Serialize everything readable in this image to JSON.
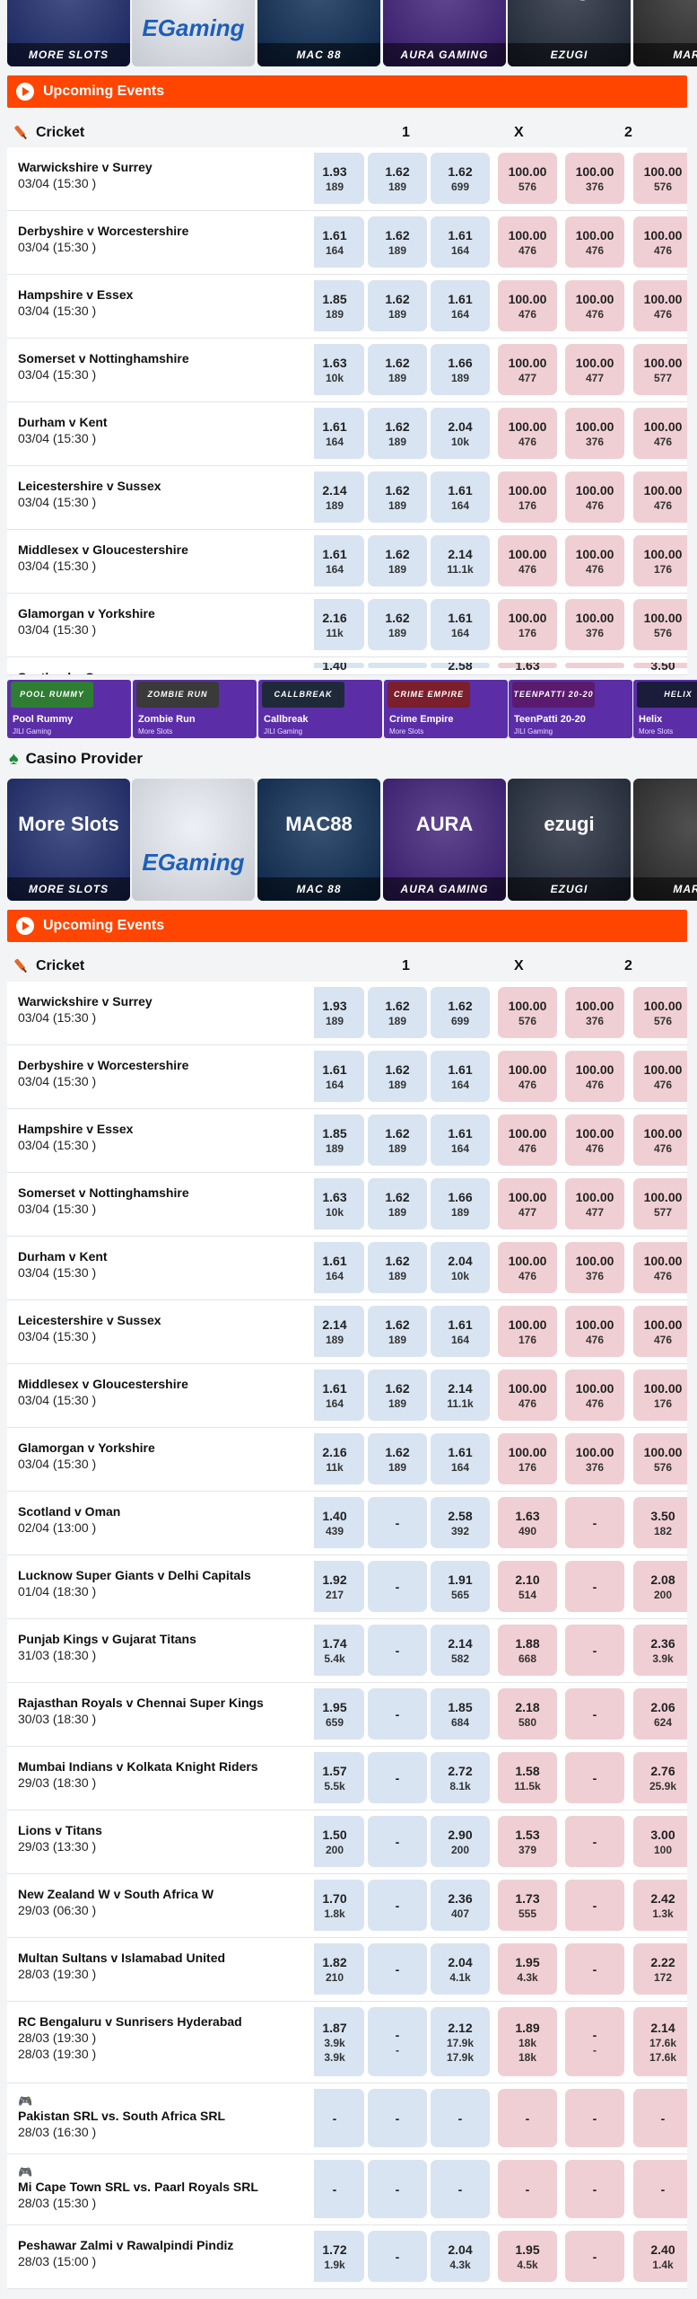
{
  "providers": [
    {
      "title": "More Slots",
      "label": "MORE SLOTS",
      "color": "#1b2a6b"
    },
    {
      "title": "EGaming",
      "label": "",
      "color": "#e9eef5"
    },
    {
      "title": "MAC88",
      "label": "MAC 88",
      "color": "#0b2b52"
    },
    {
      "title": "AURA",
      "label": "AURA GAMING",
      "color": "#3d1d78"
    },
    {
      "title": "ezugi",
      "label": "EZUGI",
      "color": "#222a3a"
    },
    {
      "title": "",
      "label": "MARBL",
      "color": "#2b2b2b"
    }
  ],
  "upcoming": {
    "title": "Upcoming Events"
  },
  "sport": {
    "name": "Cricket",
    "col1": "1",
    "colx": "X",
    "col2": "2"
  },
  "casino_provider": {
    "title": "Casino Provider"
  },
  "games": [
    {
      "banner": "POOL RUMMY",
      "name": "Pool Rummy",
      "provider": "JILI Gaming",
      "color": "#2e7d32"
    },
    {
      "banner": "ZOMBIE RUN",
      "name": "Zombie Run",
      "provider": "More Slots",
      "color": "#3a3a3a"
    },
    {
      "banner": "CALLBREAK",
      "name": "Callbreak",
      "provider": "JILI Gaming",
      "color": "#1e2a3a"
    },
    {
      "banner": "CRIME EMPIRE",
      "name": "Crime Empire",
      "provider": "More Slots",
      "color": "#7a1f2b"
    },
    {
      "banner": "TEENPATTI 20-20",
      "name": "TeenPatti 20-20",
      "provider": "JILI Gaming",
      "color": "#5a1b6e"
    },
    {
      "banner": "HELIX",
      "name": "Helix",
      "provider": "More Slots",
      "color": "#1b1b3a"
    }
  ],
  "events_top": [
    {
      "name": "Warwickshire v Surrey",
      "date": "03/04 (15:30 )",
      "odds": [
        [
          "1.93",
          "189"
        ],
        [
          "1.62",
          "189"
        ],
        [
          "1.62",
          "699"
        ],
        [
          "100.00",
          "576"
        ],
        [
          "100.00",
          "376"
        ],
        [
          "100.00",
          "576"
        ]
      ]
    },
    {
      "name": "Derbyshire v Worcestershire",
      "date": "03/04 (15:30 )",
      "odds": [
        [
          "1.61",
          "164"
        ],
        [
          "1.62",
          "189"
        ],
        [
          "1.61",
          "164"
        ],
        [
          "100.00",
          "476"
        ],
        [
          "100.00",
          "476"
        ],
        [
          "100.00",
          "476"
        ]
      ]
    },
    {
      "name": "Hampshire v Essex",
      "date": "03/04 (15:30 )",
      "odds": [
        [
          "1.85",
          "189"
        ],
        [
          "1.62",
          "189"
        ],
        [
          "1.61",
          "164"
        ],
        [
          "100.00",
          "476"
        ],
        [
          "100.00",
          "476"
        ],
        [
          "100.00",
          "476"
        ]
      ]
    },
    {
      "name": "Somerset v Nottinghamshire",
      "date": "03/04 (15:30 )",
      "odds": [
        [
          "1.63",
          "10k"
        ],
        [
          "1.62",
          "189"
        ],
        [
          "1.66",
          "189"
        ],
        [
          "100.00",
          "477"
        ],
        [
          "100.00",
          "477"
        ],
        [
          "100.00",
          "577"
        ]
      ]
    },
    {
      "name": "Durham v Kent",
      "date": "03/04 (15:30 )",
      "odds": [
        [
          "1.61",
          "164"
        ],
        [
          "1.62",
          "189"
        ],
        [
          "2.04",
          "10k"
        ],
        [
          "100.00",
          "476"
        ],
        [
          "100.00",
          "376"
        ],
        [
          "100.00",
          "476"
        ]
      ]
    },
    {
      "name": "Leicestershire v Sussex",
      "date": "03/04 (15:30 )",
      "odds": [
        [
          "2.14",
          "189"
        ],
        [
          "1.62",
          "189"
        ],
        [
          "1.61",
          "164"
        ],
        [
          "100.00",
          "176"
        ],
        [
          "100.00",
          "476"
        ],
        [
          "100.00",
          "476"
        ]
      ]
    },
    {
      "name": "Middlesex v Gloucestershire",
      "date": "03/04 (15:30 )",
      "odds": [
        [
          "1.61",
          "164"
        ],
        [
          "1.62",
          "189"
        ],
        [
          "2.14",
          "11.1k"
        ],
        [
          "100.00",
          "476"
        ],
        [
          "100.00",
          "476"
        ],
        [
          "100.00",
          "176"
        ]
      ]
    },
    {
      "name": "Glamorgan v Yorkshire",
      "date": "03/04 (15:30 )",
      "odds": [
        [
          "2.16",
          "11k"
        ],
        [
          "1.62",
          "189"
        ],
        [
          "1.61",
          "164"
        ],
        [
          "100.00",
          "176"
        ],
        [
          "100.00",
          "376"
        ],
        [
          "100.00",
          "576"
        ]
      ]
    },
    {
      "name": "Scotland v Oman",
      "date": "",
      "odds": [
        [
          "1.40",
          ""
        ],
        [
          "",
          ""
        ],
        [
          "2.58",
          ""
        ],
        [
          "1.63",
          ""
        ],
        [
          "",
          ""
        ],
        [
          "3.50",
          ""
        ]
      ]
    }
  ],
  "events": [
    {
      "name": "Warwickshire v Surrey",
      "date": "03/04 (15:30 )",
      "odds": [
        [
          "1.93",
          "189"
        ],
        [
          "1.62",
          "189"
        ],
        [
          "1.62",
          "699"
        ],
        [
          "100.00",
          "576"
        ],
        [
          "100.00",
          "376"
        ],
        [
          "100.00",
          "576"
        ]
      ]
    },
    {
      "name": "Derbyshire v Worcestershire",
      "date": "03/04 (15:30 )",
      "odds": [
        [
          "1.61",
          "164"
        ],
        [
          "1.62",
          "189"
        ],
        [
          "1.61",
          "164"
        ],
        [
          "100.00",
          "476"
        ],
        [
          "100.00",
          "476"
        ],
        [
          "100.00",
          "476"
        ]
      ]
    },
    {
      "name": "Hampshire v Essex",
      "date": "03/04 (15:30 )",
      "odds": [
        [
          "1.85",
          "189"
        ],
        [
          "1.62",
          "189"
        ],
        [
          "1.61",
          "164"
        ],
        [
          "100.00",
          "476"
        ],
        [
          "100.00",
          "476"
        ],
        [
          "100.00",
          "476"
        ]
      ]
    },
    {
      "name": "Somerset v Nottinghamshire",
      "date": "03/04 (15:30 )",
      "odds": [
        [
          "1.63",
          "10k"
        ],
        [
          "1.62",
          "189"
        ],
        [
          "1.66",
          "189"
        ],
        [
          "100.00",
          "477"
        ],
        [
          "100.00",
          "477"
        ],
        [
          "100.00",
          "577"
        ]
      ]
    },
    {
      "name": "Durham v Kent",
      "date": "03/04 (15:30 )",
      "odds": [
        [
          "1.61",
          "164"
        ],
        [
          "1.62",
          "189"
        ],
        [
          "2.04",
          "10k"
        ],
        [
          "100.00",
          "476"
        ],
        [
          "100.00",
          "376"
        ],
        [
          "100.00",
          "476"
        ]
      ]
    },
    {
      "name": "Leicestershire v Sussex",
      "date": "03/04 (15:30 )",
      "odds": [
        [
          "2.14",
          "189"
        ],
        [
          "1.62",
          "189"
        ],
        [
          "1.61",
          "164"
        ],
        [
          "100.00",
          "176"
        ],
        [
          "100.00",
          "476"
        ],
        [
          "100.00",
          "476"
        ]
      ]
    },
    {
      "name": "Middlesex v Gloucestershire",
      "date": "03/04 (15:30 )",
      "odds": [
        [
          "1.61",
          "164"
        ],
        [
          "1.62",
          "189"
        ],
        [
          "2.14",
          "11.1k"
        ],
        [
          "100.00",
          "476"
        ],
        [
          "100.00",
          "476"
        ],
        [
          "100.00",
          "176"
        ]
      ]
    },
    {
      "name": "Glamorgan v Yorkshire",
      "date": "03/04 (15:30 )",
      "odds": [
        [
          "2.16",
          "11k"
        ],
        [
          "1.62",
          "189"
        ],
        [
          "1.61",
          "164"
        ],
        [
          "100.00",
          "176"
        ],
        [
          "100.00",
          "376"
        ],
        [
          "100.00",
          "576"
        ]
      ]
    },
    {
      "name": "Scotland v Oman",
      "date": "02/04 (13:00 )",
      "odds": [
        [
          "1.40",
          "439"
        ],
        [
          "-",
          ""
        ],
        [
          "2.58",
          "392"
        ],
        [
          "1.63",
          "490"
        ],
        [
          "-",
          ""
        ],
        [
          "3.50",
          "182"
        ]
      ]
    },
    {
      "name": "Lucknow Super Giants v Delhi Capitals",
      "date": "01/04 (18:30 )",
      "odds": [
        [
          "1.92",
          "217"
        ],
        [
          "-",
          ""
        ],
        [
          "1.91",
          "565"
        ],
        [
          "2.10",
          "514"
        ],
        [
          "-",
          ""
        ],
        [
          "2.08",
          "200"
        ]
      ]
    },
    {
      "name": "Punjab Kings v Gujarat Titans",
      "date": "31/03 (18:30 )",
      "odds": [
        [
          "1.74",
          "5.4k"
        ],
        [
          "-",
          ""
        ],
        [
          "2.14",
          "582"
        ],
        [
          "1.88",
          "668"
        ],
        [
          "-",
          ""
        ],
        [
          "2.36",
          "3.9k"
        ]
      ]
    },
    {
      "name": "Rajasthan Royals v Chennai Super Kings",
      "date": "30/03 (18:30 )",
      "odds": [
        [
          "1.95",
          "659"
        ],
        [
          "-",
          ""
        ],
        [
          "1.85",
          "684"
        ],
        [
          "2.18",
          "580"
        ],
        [
          "-",
          ""
        ],
        [
          "2.06",
          "624"
        ]
      ]
    },
    {
      "name": "Mumbai Indians v Kolkata Knight Riders",
      "date": "29/03 (18:30 )",
      "odds": [
        [
          "1.57",
          "5.5k"
        ],
        [
          "-",
          ""
        ],
        [
          "2.72",
          "8.1k"
        ],
        [
          "1.58",
          "11.5k"
        ],
        [
          "-",
          ""
        ],
        [
          "2.76",
          "25.9k"
        ]
      ]
    },
    {
      "name": "Lions v Titans",
      "date": "29/03 (13:30 )",
      "odds": [
        [
          "1.50",
          "200"
        ],
        [
          "-",
          ""
        ],
        [
          "2.90",
          "200"
        ],
        [
          "1.53",
          "379"
        ],
        [
          "-",
          ""
        ],
        [
          "3.00",
          "100"
        ]
      ]
    },
    {
      "name": "New Zealand W v South Africa W",
      "date": "29/03 (06:30 )",
      "odds": [
        [
          "1.70",
          "1.8k"
        ],
        [
          "-",
          ""
        ],
        [
          "2.36",
          "407"
        ],
        [
          "1.73",
          "555"
        ],
        [
          "-",
          ""
        ],
        [
          "2.42",
          "1.3k"
        ]
      ]
    },
    {
      "name": "Multan Sultans v Islamabad United",
      "date": "28/03 (19:30 )",
      "odds": [
        [
          "1.82",
          "210"
        ],
        [
          "-",
          ""
        ],
        [
          "2.04",
          "4.1k"
        ],
        [
          "1.95",
          "4.3k"
        ],
        [
          "-",
          ""
        ],
        [
          "2.22",
          "172"
        ]
      ]
    },
    {
      "name": "RC Bengaluru v Sunrisers Hyderabad",
      "date": "28/03 (19:30 )",
      "date2": "28/03 (19:30 )",
      "odds": [
        [
          "1.87",
          "3.9k",
          "3.9k"
        ],
        [
          "-",
          "",
          "-"
        ],
        [
          "2.12",
          "17.9k",
          "17.9k"
        ],
        [
          "1.89",
          "18k",
          "18k"
        ],
        [
          "-",
          "",
          "-"
        ],
        [
          "2.14",
          "17.6k",
          "17.6k"
        ]
      ]
    },
    {
      "name": "Pakistan SRL vs. South Africa SRL",
      "date": "28/03 (16:30 )",
      "gaming": true,
      "odds": [
        [
          "-",
          ""
        ],
        [
          "-",
          ""
        ],
        [
          "-",
          ""
        ],
        [
          "-",
          ""
        ],
        [
          "-",
          ""
        ],
        [
          "-",
          ""
        ]
      ]
    },
    {
      "name": "Mi Cape Town SRL vs. Paarl Royals SRL",
      "date": "28/03 (15:30 )",
      "gaming": true,
      "odds": [
        [
          "-",
          ""
        ],
        [
          "-",
          ""
        ],
        [
          "-",
          ""
        ],
        [
          "-",
          ""
        ],
        [
          "-",
          ""
        ],
        [
          "-",
          ""
        ]
      ]
    },
    {
      "name": "Peshawar Zalmi v Rawalpindi Pindiz",
      "date": "28/03 (15:00 )",
      "odds": [
        [
          "1.72",
          "1.9k"
        ],
        [
          "-",
          ""
        ],
        [
          "2.04",
          "4.3k"
        ],
        [
          "1.95",
          "4.5k"
        ],
        [
          "-",
          ""
        ],
        [
          "2.40",
          "1.4k"
        ]
      ]
    }
  ]
}
